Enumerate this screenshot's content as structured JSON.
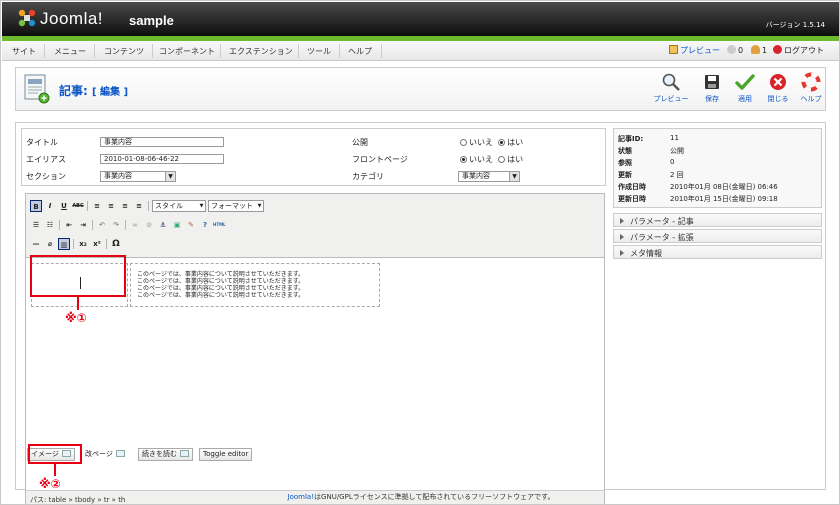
{
  "header": {
    "logo_text": "Joomla!",
    "site_name": "sample",
    "version": "バージョン 1.5.14"
  },
  "menu": [
    "サイト",
    "メニュー",
    "コンテンツ",
    "コンポーネント",
    "エクステンション",
    "ツール",
    "ヘルプ"
  ],
  "status": {
    "preview": "プレビュー",
    "messages": "0",
    "users": "1",
    "logout": "ログアウト"
  },
  "toolbar": {
    "title": "記事:",
    "subtitle": "[ 編集 ]",
    "buttons": [
      "プレビュー",
      "保存",
      "適用",
      "閉じる",
      "ヘルプ"
    ]
  },
  "form": {
    "title_label": "タイトル",
    "title_value": "事業内容",
    "alias_label": "エイリアス",
    "alias_value": "2010-01-08-06-46-22",
    "section_label": "セクション",
    "section_value": "事業内容",
    "published_label": "公開",
    "frontpage_label": "フロントページ",
    "category_label": "カテゴリ",
    "category_value": "事業内容",
    "no": "いいえ",
    "yes": "はい"
  },
  "editor": {
    "style_dropdown": "スタイル",
    "format_dropdown": "フォーマット",
    "content_lines": [
      "このページでは、事業内容について説明させていただきます。",
      "このページでは、事業内容について説明させていただきます。",
      "このページでは、事業内容について説明させていただきます。",
      "このページでは、事業内容について説明させていただきます。"
    ],
    "path": "パス: table » tbody » tr » th"
  },
  "editor_buttons": {
    "image": "イメージ",
    "pagebreak": "改ページ",
    "readmore": "続きを読む",
    "toggle": "Toggle editor"
  },
  "meta": {
    "rows": [
      {
        "key": "記事ID:",
        "value": "11"
      },
      {
        "key": "状態",
        "value": "公開"
      },
      {
        "key": "参照",
        "value": "0"
      },
      {
        "key": "更新",
        "value": "2 回"
      },
      {
        "key": "作成日時",
        "value": "2010年01月 08日(金曜日) 06:46"
      },
      {
        "key": "更新日時",
        "value": "2010年01月 15日(金曜日) 09:18"
      }
    ]
  },
  "panes": [
    "パラメータ - 記事",
    "パラメータ - 拡張",
    "メタ情報"
  ],
  "annotations": {
    "note1": "※①",
    "note2": "※②",
    "color": "#e60012"
  },
  "footer": {
    "link": "Joomla!",
    "text": "はGNU/GPLライセンスに準拠して配布されているフリーソフトウェアです。"
  }
}
